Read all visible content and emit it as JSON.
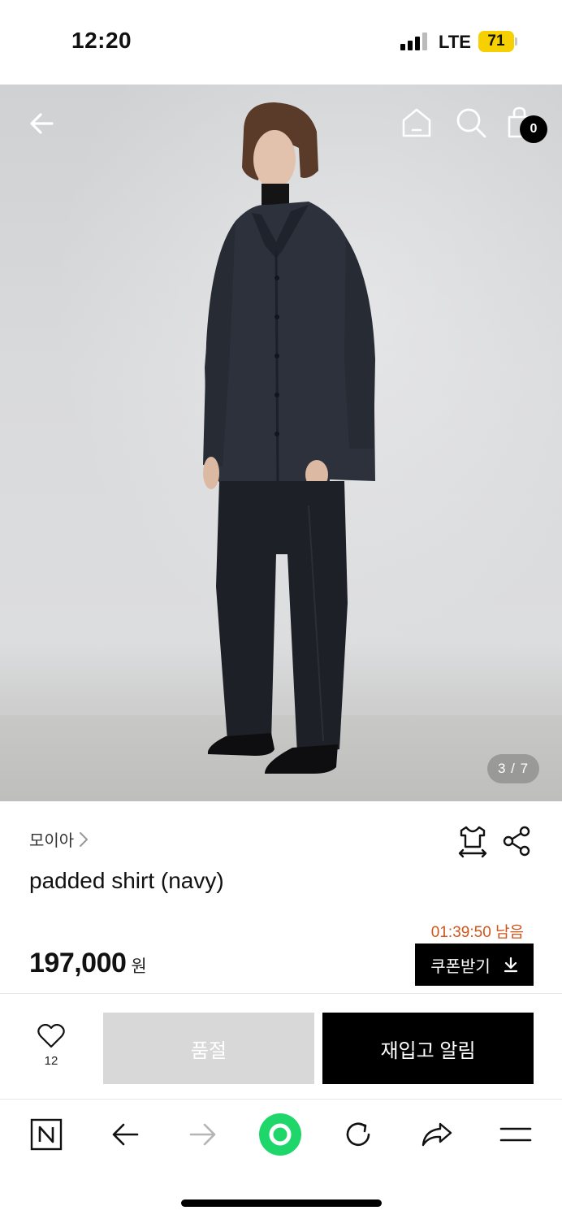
{
  "status_bar": {
    "time": "12:20",
    "network": "LTE",
    "battery": "71"
  },
  "gallery": {
    "page_indicator": "3 / 7",
    "cart_count": "0",
    "icons": [
      "back-arrow-icon",
      "home-icon",
      "search-icon",
      "shopping-bag-icon"
    ]
  },
  "product": {
    "brand": "모이아",
    "title": "padded shirt (navy)",
    "price": "197,000",
    "price_unit": "원",
    "coupon_timer": "01:39:50 남음",
    "coupon_button": "쿠폰받기"
  },
  "purchase_bar": {
    "like_count": "12",
    "soldout_label": "품절",
    "restock_label": "재입고 알림"
  },
  "browser_toolbar": {
    "items": [
      "naver-icon",
      "back-icon",
      "forward-icon",
      "green-dot-icon",
      "refresh-icon",
      "share-icon",
      "menu-icon"
    ]
  },
  "colors": {
    "accent_timer": "#d2541a",
    "battery": "#f6d000",
    "green_button": "#1ed66a"
  }
}
